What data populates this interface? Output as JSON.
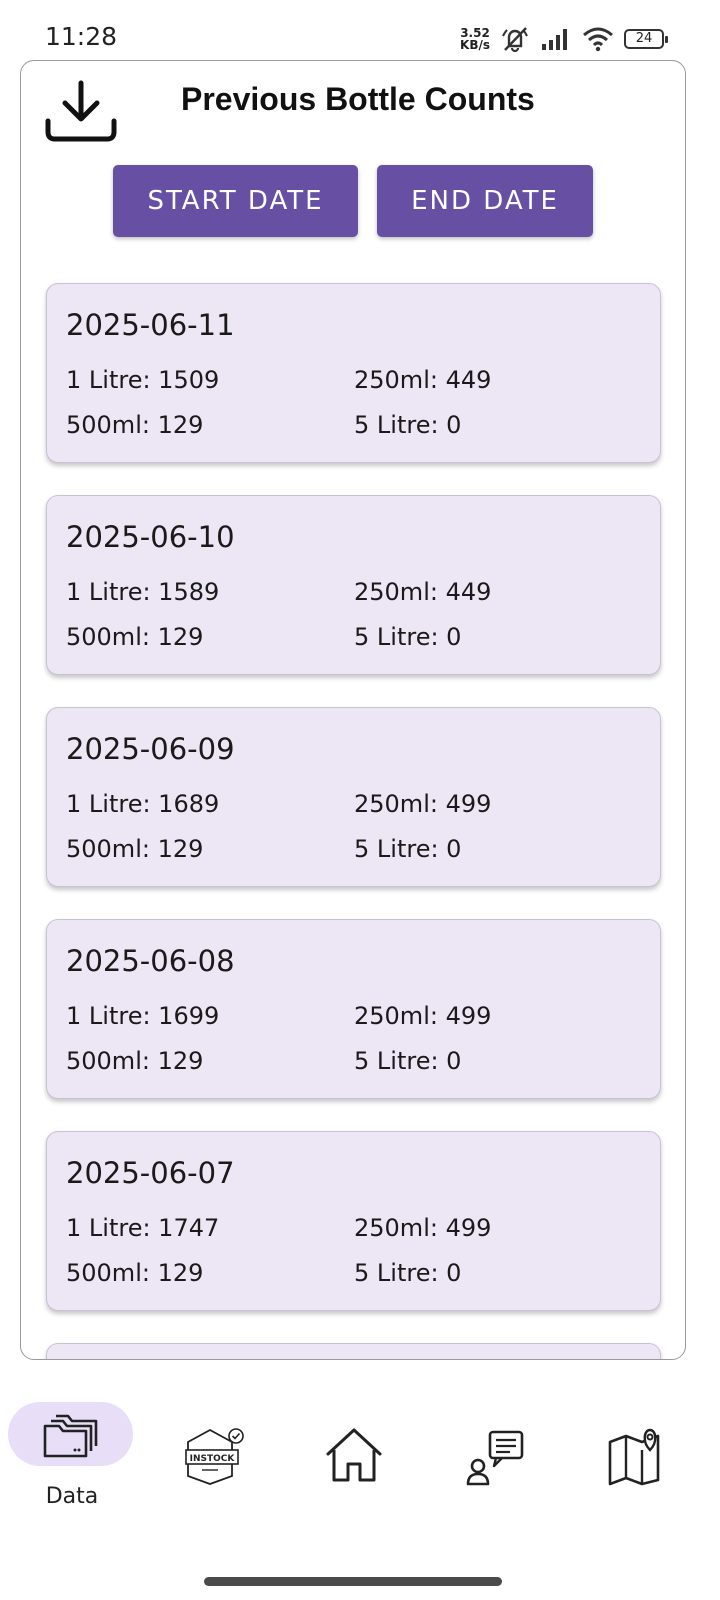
{
  "status_bar": {
    "time": "11:28",
    "net_speed_value": "3.52",
    "net_speed_unit": "KB/s",
    "battery": "24"
  },
  "header": {
    "title": "Previous Bottle Counts",
    "download_icon": "download-icon"
  },
  "filters": {
    "start_label": "START DATE",
    "end_label": "END DATE"
  },
  "records": [
    {
      "date": "2025-06-11",
      "litre1": "1 Litre: 1509",
      "ml250": "250ml: 449",
      "ml500": "500ml: 129",
      "litre5": "5 Litre: 0"
    },
    {
      "date": "2025-06-10",
      "litre1": "1 Litre: 1589",
      "ml250": "250ml: 449",
      "ml500": "500ml: 129",
      "litre5": "5 Litre: 0"
    },
    {
      "date": "2025-06-09",
      "litre1": "1 Litre: 1689",
      "ml250": "250ml: 499",
      "ml500": "500ml: 129",
      "litre5": "5 Litre: 0"
    },
    {
      "date": "2025-06-08",
      "litre1": "1 Litre: 1699",
      "ml250": "250ml: 499",
      "ml500": "500ml: 129",
      "litre5": "5 Litre: 0"
    },
    {
      "date": "2025-06-07",
      "litre1": "1 Litre: 1747",
      "ml250": "250ml: 499",
      "ml500": "500ml: 129",
      "litre5": "5 Litre: 0"
    }
  ],
  "bottom_nav": {
    "items": [
      {
        "label": "Data",
        "icon": "folders-icon",
        "active": true
      },
      {
        "label": "",
        "icon": "instock-badge-icon",
        "badge_text": "INSTOCK",
        "active": false
      },
      {
        "label": "",
        "icon": "home-icon",
        "active": false
      },
      {
        "label": "",
        "icon": "chat-person-icon",
        "active": false
      },
      {
        "label": "",
        "icon": "map-pin-icon",
        "active": false
      }
    ]
  },
  "colors": {
    "accent": "#6750a4",
    "card_bg": "#ece6f5",
    "nav_active_pill": "#e8def8"
  }
}
